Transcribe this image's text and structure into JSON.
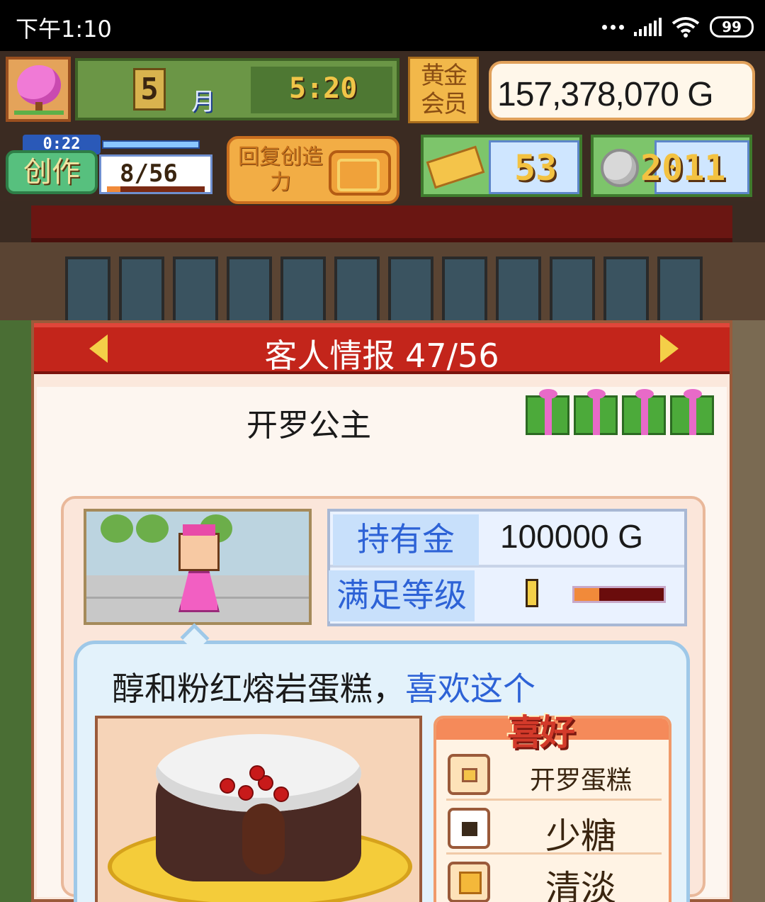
{
  "status_bar": {
    "time": "下午1:10",
    "battery": "99"
  },
  "hud": {
    "month": "5",
    "month_label": "月",
    "clock": "5:20",
    "gold_member_label": "黄金会员",
    "money": "157,378,070 G",
    "create": {
      "timer": "0:22",
      "label": "创作",
      "count": "8/56",
      "progress": 0.14
    },
    "restore_label": "回复创造力",
    "tickets": "53",
    "medals": "2011"
  },
  "panel": {
    "title": "客人情报 47/56",
    "customer_name": "开罗公主",
    "gift_count": 4,
    "stats": {
      "money_label": "持有金",
      "money_value": "100000 G",
      "satisfaction_label": "满足等级",
      "satisfaction_fill": 0.28
    },
    "speech": {
      "item": "醇和粉红熔岩蛋糕",
      "separator": "，",
      "likes": "喜欢这个"
    },
    "preferences": {
      "title": "喜好",
      "items": [
        {
          "icon": "box-icon",
          "label": "开罗蛋糕"
        },
        {
          "icon": "square-icon",
          "label": "少糖"
        },
        {
          "icon": "cube-icon",
          "label": "清淡"
        }
      ]
    }
  },
  "colors": {
    "header_red": "#c3251b",
    "accent_blue": "#2d62d6",
    "gold": "#f3c241"
  }
}
